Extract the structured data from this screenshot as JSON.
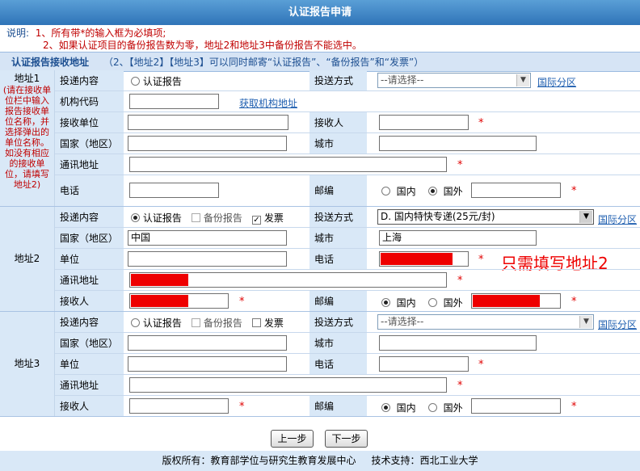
{
  "title": "认证报告申请",
  "notes": {
    "label": "说明:",
    "line1": "1、所有带*的输入框为必填项;",
    "line2": "2、如果认证项目的备份报告数为零，地址2和地址3中备份报告不能选中。"
  },
  "section": {
    "title": "认证报告接收地址",
    "hint": "（2、【地址2】【地址3】可以同时邮寄“认证报告”、“备份报告”和“发票”）"
  },
  "labels": {
    "content": "投递内容",
    "delivery": "投送方式",
    "org_code": "机构代码",
    "get_org": "获取机构地址",
    "recv_unit": "接收单位",
    "receiver": "接收人",
    "country": "国家（地区）",
    "city": "城市",
    "address": "通讯地址",
    "phone": "电话",
    "zip": "邮编",
    "unit": "单位",
    "domestic": "国内",
    "foreign": "国外",
    "intl": "国际分区",
    "report": "认证报告",
    "backup": "备份报告",
    "invoice": "发票",
    "required": "*"
  },
  "addr1": {
    "label": "地址1",
    "help": "(请在接收单位栏中输入报告接收单位名称，并选择弹出的单位名称。如没有相应的接收单位，请填写地址2)",
    "delivery_placeholder": "--请选择--"
  },
  "addr2": {
    "label": "地址2",
    "delivery_value": "D. 国内特快专递(25元/封)",
    "country_value": "中国",
    "city_value": "上海",
    "note": "只需填写地址2"
  },
  "addr3": {
    "label": "地址3",
    "delivery_placeholder": "--请选择--"
  },
  "buttons": {
    "prev": "上一步",
    "next": "下一步"
  },
  "footer": {
    "copyright": "版权所有：教育部学位与研究生教育发展中心",
    "support": "技术支持：西北工业大学"
  }
}
